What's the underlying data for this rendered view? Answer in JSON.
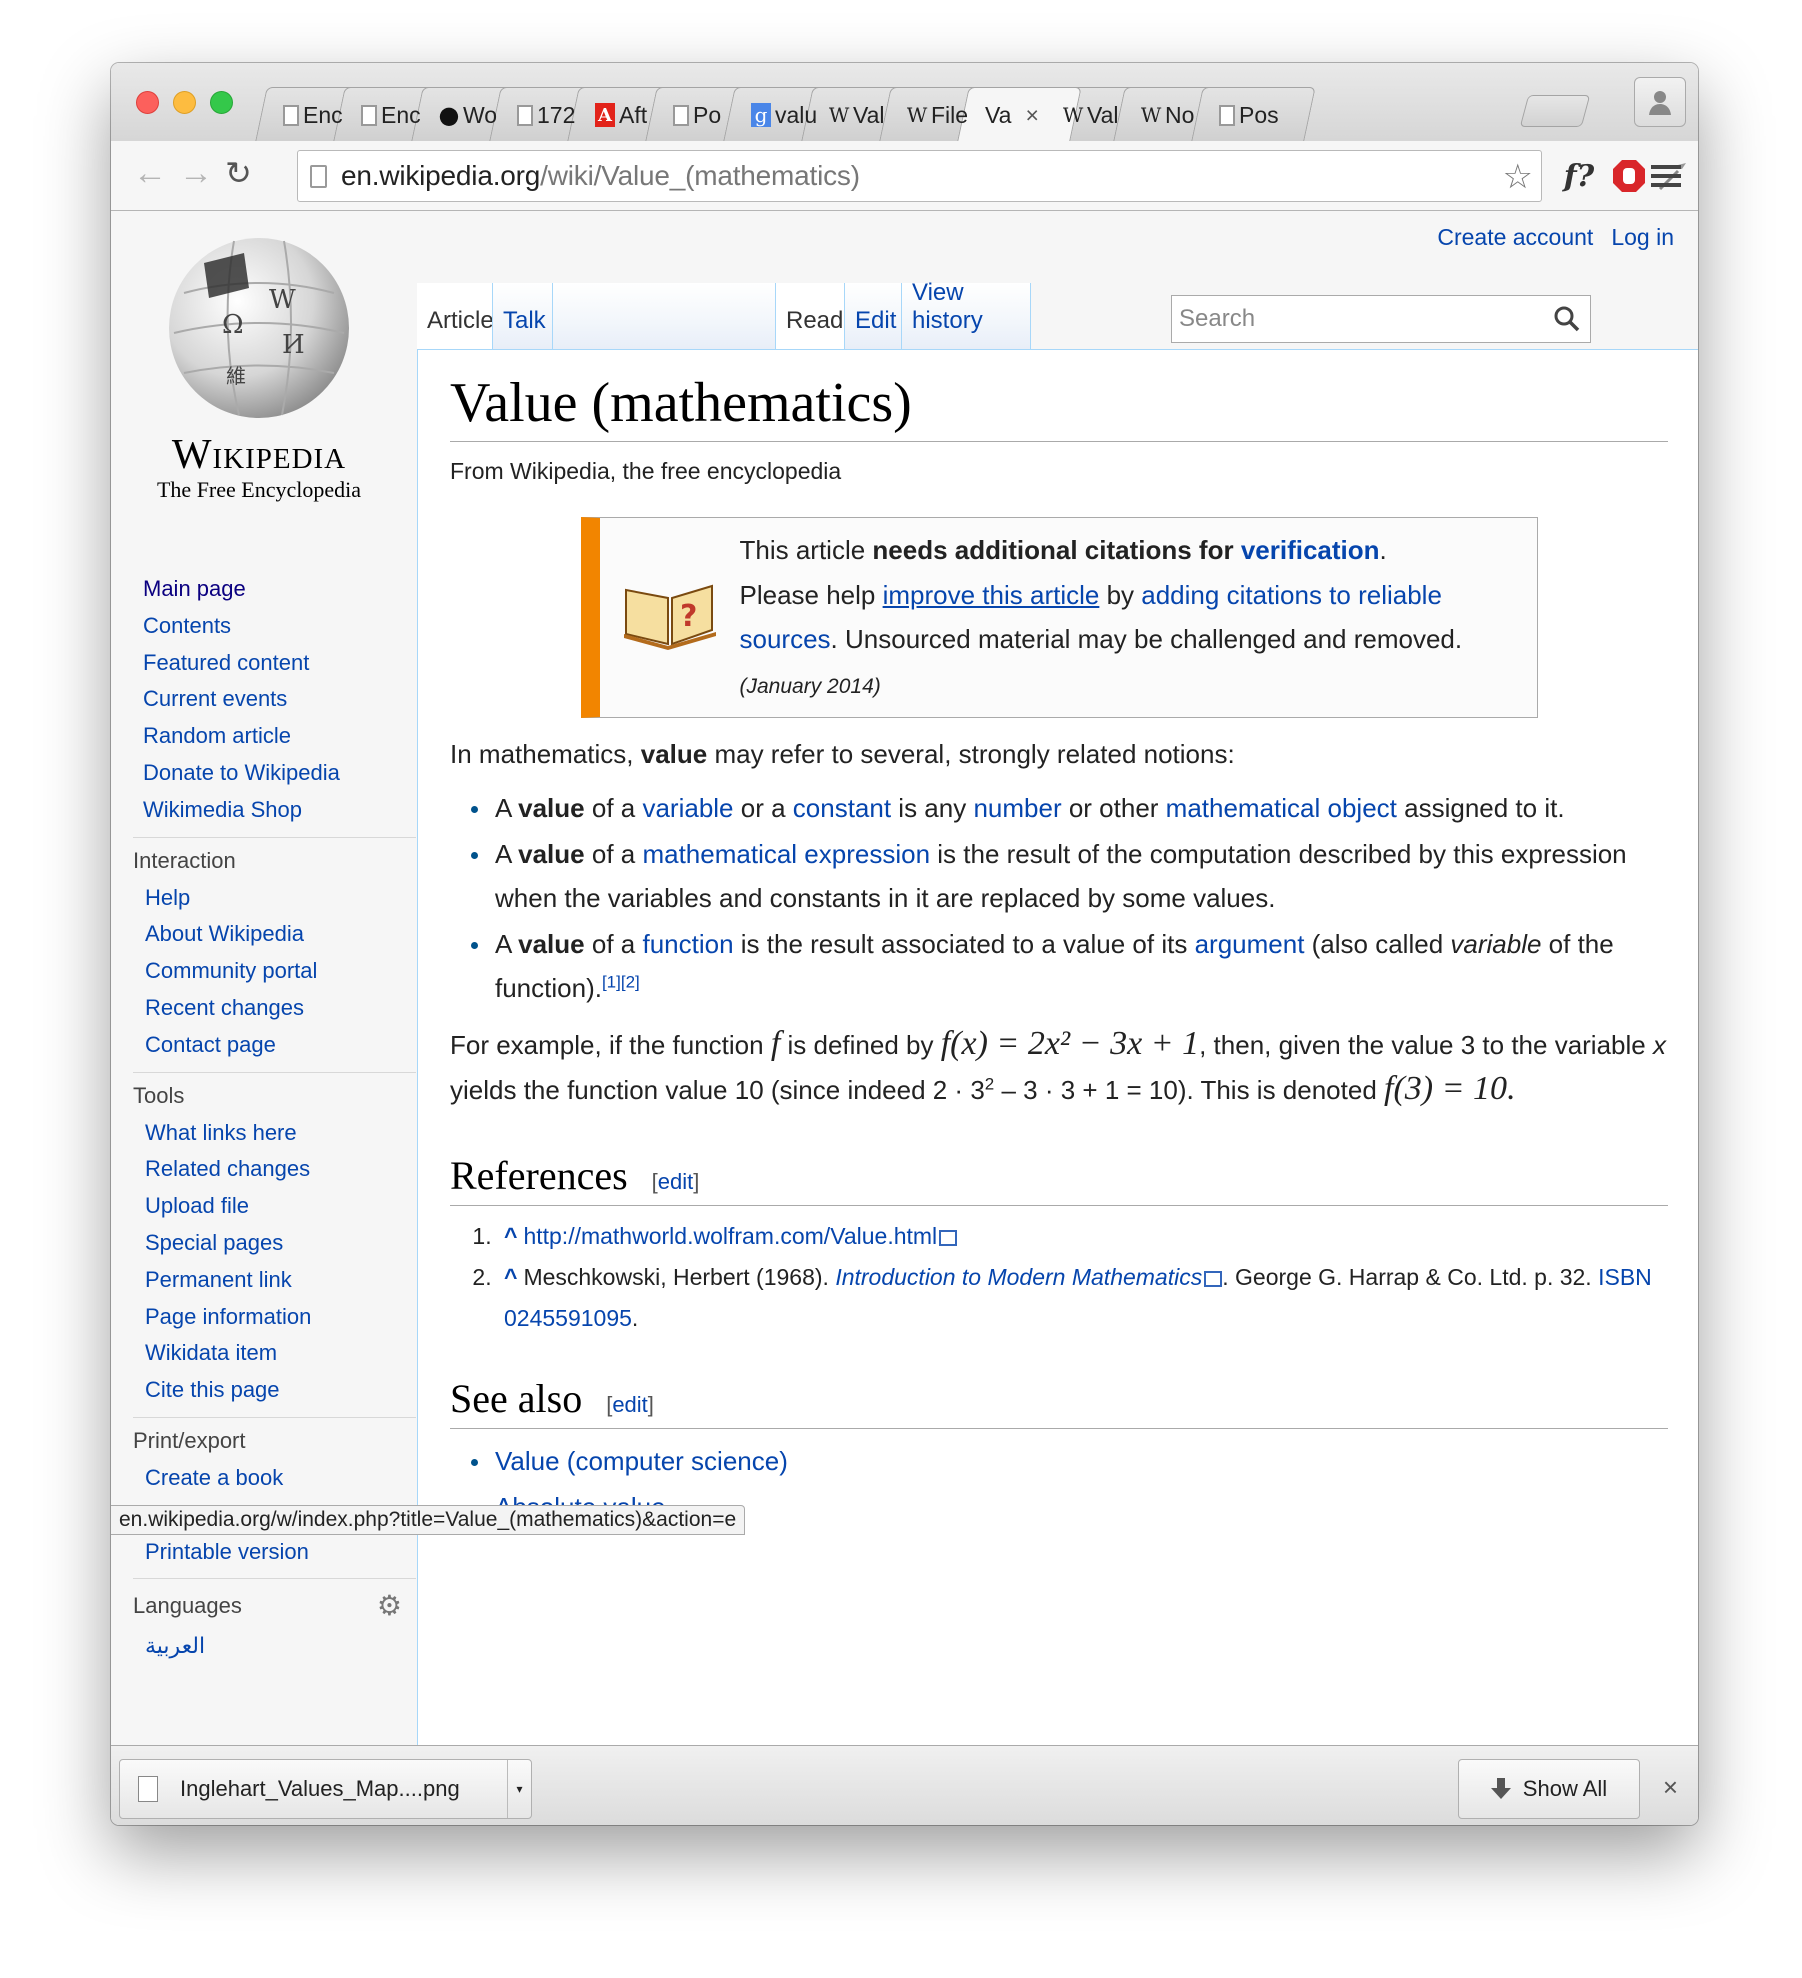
{
  "browser": {
    "tabs": [
      {
        "label": "Enc",
        "icon": "doc-icon"
      },
      {
        "label": "Enc",
        "icon": "doc-icon"
      },
      {
        "label": "Wo",
        "icon": "github-icon"
      },
      {
        "label": "172",
        "icon": "doc-icon"
      },
      {
        "label": "Aft",
        "icon": "adobe-icon"
      },
      {
        "label": "Po",
        "icon": "doc-icon"
      },
      {
        "label": "valu",
        "icon": "google-icon"
      },
      {
        "label": "Val",
        "icon": "wikipedia-icon"
      },
      {
        "label": "File",
        "icon": "wikipedia-icon"
      },
      {
        "label": "Va",
        "icon": "none",
        "active": true
      },
      {
        "label": "Val",
        "icon": "wikipedia-icon"
      },
      {
        "label": "No",
        "icon": "wikipedia-icon"
      },
      {
        "label": "Pos",
        "icon": "doc-icon"
      }
    ],
    "active_tab_close": "×",
    "url_host": "en.wikipedia.org",
    "url_path": "/wiki/Value_(mathematics)",
    "status_url": "en.wikipedia.org/w/index.php?title=Value_(mathematics)&action=e",
    "ext_f": "f?"
  },
  "downloads": {
    "file": "Inglehart_Values_Map....png",
    "show_all": "Show All",
    "close": "×"
  },
  "wiki": {
    "create_account": "Create account",
    "log_in": "Log in",
    "wordmark": "Wikipedia",
    "tagline": "The Free Encyclopedia",
    "tabs": {
      "article": "Article",
      "talk": "Talk",
      "read": "Read",
      "edit": "Edit",
      "history": "View history"
    },
    "search_placeholder": "Search",
    "nav": [
      "Main page",
      "Contents",
      "Featured content",
      "Current events",
      "Random article",
      "Donate to Wikipedia",
      "Wikimedia Shop"
    ],
    "interaction_title": "Interaction",
    "interaction": [
      "Help",
      "About Wikipedia",
      "Community portal",
      "Recent changes",
      "Contact page"
    ],
    "tools_title": "Tools",
    "tools": [
      "What links here",
      "Related changes",
      "Upload file",
      "Special pages",
      "Permanent link",
      "Page information",
      "Wikidata item",
      "Cite this page"
    ],
    "print_title": "Print/export",
    "print": [
      "Create a book",
      "Download as PDF",
      "Printable version"
    ],
    "languages_title": "Languages",
    "languages": [
      "العربية"
    ]
  },
  "article": {
    "title": "Value (mathematics)",
    "subtitle": "From Wikipedia, the free encyclopedia",
    "ambox": {
      "t1": "This article ",
      "t2": "needs additional citations for ",
      "t3": "verification",
      "t4": ".",
      "t5": "Please help ",
      "t6": "improve this article",
      "t7": " by ",
      "t8": "adding citations to reliable sources",
      "t9": ". Unsourced material may be challenged and removed. ",
      "date": "(January 2014)"
    },
    "intro": {
      "a": "In mathematics, ",
      "b": "value",
      "c": " may refer to several, strongly related notions:"
    },
    "bullets": {
      "b1": {
        "a": "A ",
        "b": "value",
        "c": " of a ",
        "d": "variable",
        "e": " or a ",
        "f": "constant",
        "g": " is any ",
        "h": "number",
        "i": " or other ",
        "j": "mathematical object",
        "k": " assigned to it."
      },
      "b2": {
        "a": "A ",
        "b": "value",
        "c": " of a ",
        "d": "mathematical expression",
        "e": " is the result of the computation described by this expression when the variables and constants in it are replaced by some values."
      },
      "b3": {
        "a": "A ",
        "b": "value",
        "c": " of a ",
        "d": "function",
        "e": " is the result associated to a value of its ",
        "f": "argument",
        "g": " (also called ",
        "h": "variable",
        "i": " of the function).",
        "r1": "[1]",
        "r2": "[2]"
      }
    },
    "example": {
      "a": "For example, if the function ",
      "f": "f",
      "b": " is defined by ",
      "eq1": "f(x) = 2x² − 3x + 1",
      "c": ", then, given the value 3 to the variable ",
      "x": "x",
      "d": " yields the function value 10 (since indeed 2 · 3",
      "sq": "2",
      "e": " – 3 · 3 + 1 = 10). This is denoted ",
      "eq2": "f(3) = 10",
      "g": "."
    },
    "references_title": "References",
    "edit_label": "edit",
    "ref1": {
      "caret": "^",
      "link": "http://mathworld.wolfram.com/Value.html"
    },
    "ref2": {
      "caret": "^",
      "a": "Meschkowski, Herbert (1968). ",
      "title": "Introduction to Modern Mathematics",
      "b": ". George G. Harrap & Co. Ltd. p. 32. ",
      "isbn": "ISBN 0245591095",
      "c": "."
    },
    "see_also_title": "See also",
    "see_also": [
      "Value (computer science)",
      "Absolute value"
    ]
  }
}
